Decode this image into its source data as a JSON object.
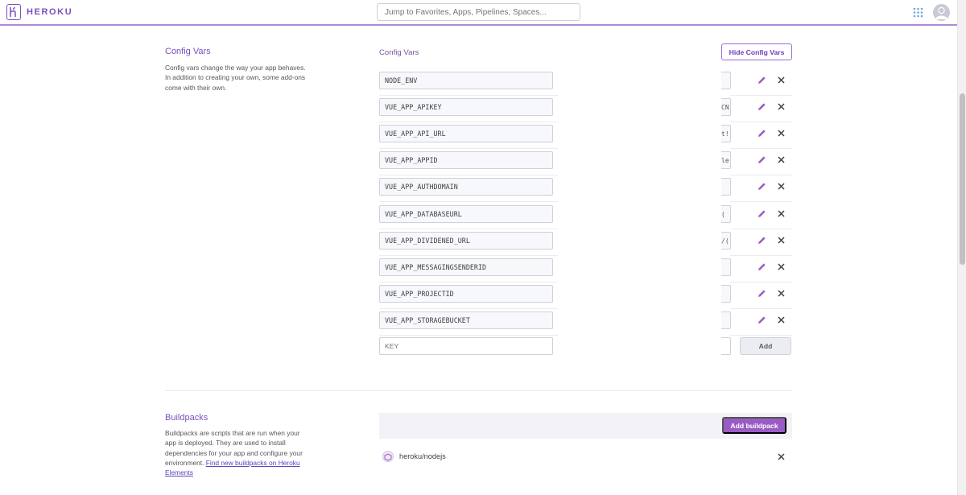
{
  "header": {
    "logo_text": "HEROKU",
    "search_placeholder": "Jump to Favorites, Apps, Pipelines, Spaces...",
    "icons": [
      "heroku-logo-icon",
      "apps-grid-icon",
      "avatar-icon"
    ]
  },
  "config_vars": {
    "section_title": "Config Vars",
    "description": "Config vars change the way your app behaves. In addition to creating your own, some add-ons come with their own.",
    "table_label": "Config Vars",
    "hide_button": "Hide Config Vars",
    "rows": [
      {
        "key": "NODE_ENV",
        "value_fragment": ""
      },
      {
        "key": "VUE_APP_APIKEY",
        "value_fragment": "CN"
      },
      {
        "key": "VUE_APP_API_URL",
        "value_fragment": "t!"
      },
      {
        "key": "VUE_APP_APPID",
        "value_fragment": "le"
      },
      {
        "key": "VUE_APP_AUTHDOMAIN",
        "value_fragment": ""
      },
      {
        "key": "VUE_APP_DATABASEURL",
        "value_fragment": "("
      },
      {
        "key": "VUE_APP_DIVIDENED_URL",
        "value_fragment": "/("
      },
      {
        "key": "VUE_APP_MESSAGINGSENDERID",
        "value_fragment": ""
      },
      {
        "key": "VUE_APP_PROJECTID",
        "value_fragment": ""
      },
      {
        "key": "VUE_APP_STORAGEBUCKET",
        "value_fragment": ""
      }
    ],
    "new_key_placeholder": "KEY",
    "add_button": "Add"
  },
  "buildpacks": {
    "section_title": "Buildpacks",
    "description": "Buildpacks are scripts that are run when your app is deployed. They are used to install dependencies for your app and configure your environment.",
    "link_text": "Find new buildpacks on Heroku Elements",
    "add_button": "Add buildpack",
    "items": [
      {
        "name": "heroku/nodejs"
      }
    ]
  },
  "colors": {
    "brand": "#7c4fbf",
    "accent_button": "#9a5cc4"
  }
}
